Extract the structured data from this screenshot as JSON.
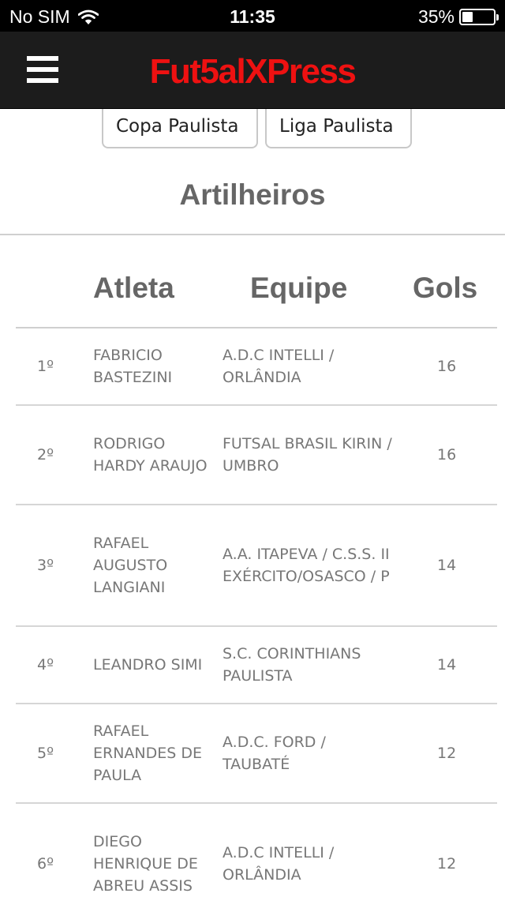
{
  "status_bar": {
    "carrier": "No SIM",
    "time": "11:35",
    "battery_label": "35%",
    "battery_level": 0.35
  },
  "header": {
    "logo": "Fut5alXPress"
  },
  "tabs": [
    {
      "label": "Copa Paulista"
    },
    {
      "label": "Liga Paulista"
    }
  ],
  "section_title": "Artilheiros",
  "table": {
    "columns": {
      "atleta": "Atleta",
      "equipe": "Equipe",
      "gols": "Gols"
    },
    "rows": [
      {
        "pos": "1º",
        "name": "FABRICIO BASTEZINI",
        "team": "A.D.C INTELLI / ORLÂNDIA",
        "gols": "16"
      },
      {
        "pos": "2º",
        "name": "RODRIGO HARDY ARAUJO",
        "team": "FUTSAL BRASIL KIRIN / UMBRO",
        "gols": "16"
      },
      {
        "pos": "3º",
        "name": "RAFAEL AUGUSTO LANGIANI",
        "team": "A.A. ITAPEVA / C.S.S. II EXÉRCITO/OSASCO / P",
        "gols": "14"
      },
      {
        "pos": "4º",
        "name": "LEANDRO SIMI",
        "team": "S.C. CORINTHIANS PAULISTA",
        "gols": "14"
      },
      {
        "pos": "5º",
        "name": "RAFAEL ERNANDES DE PAULA",
        "team": "A.D.C. FORD / TAUBATÉ",
        "gols": "12"
      },
      {
        "pos": "6º",
        "name": "DIEGO HENRIQUE DE ABREU ASSIS",
        "team": "A.D.C INTELLI / ORLÂNDIA",
        "gols": "12"
      }
    ]
  }
}
